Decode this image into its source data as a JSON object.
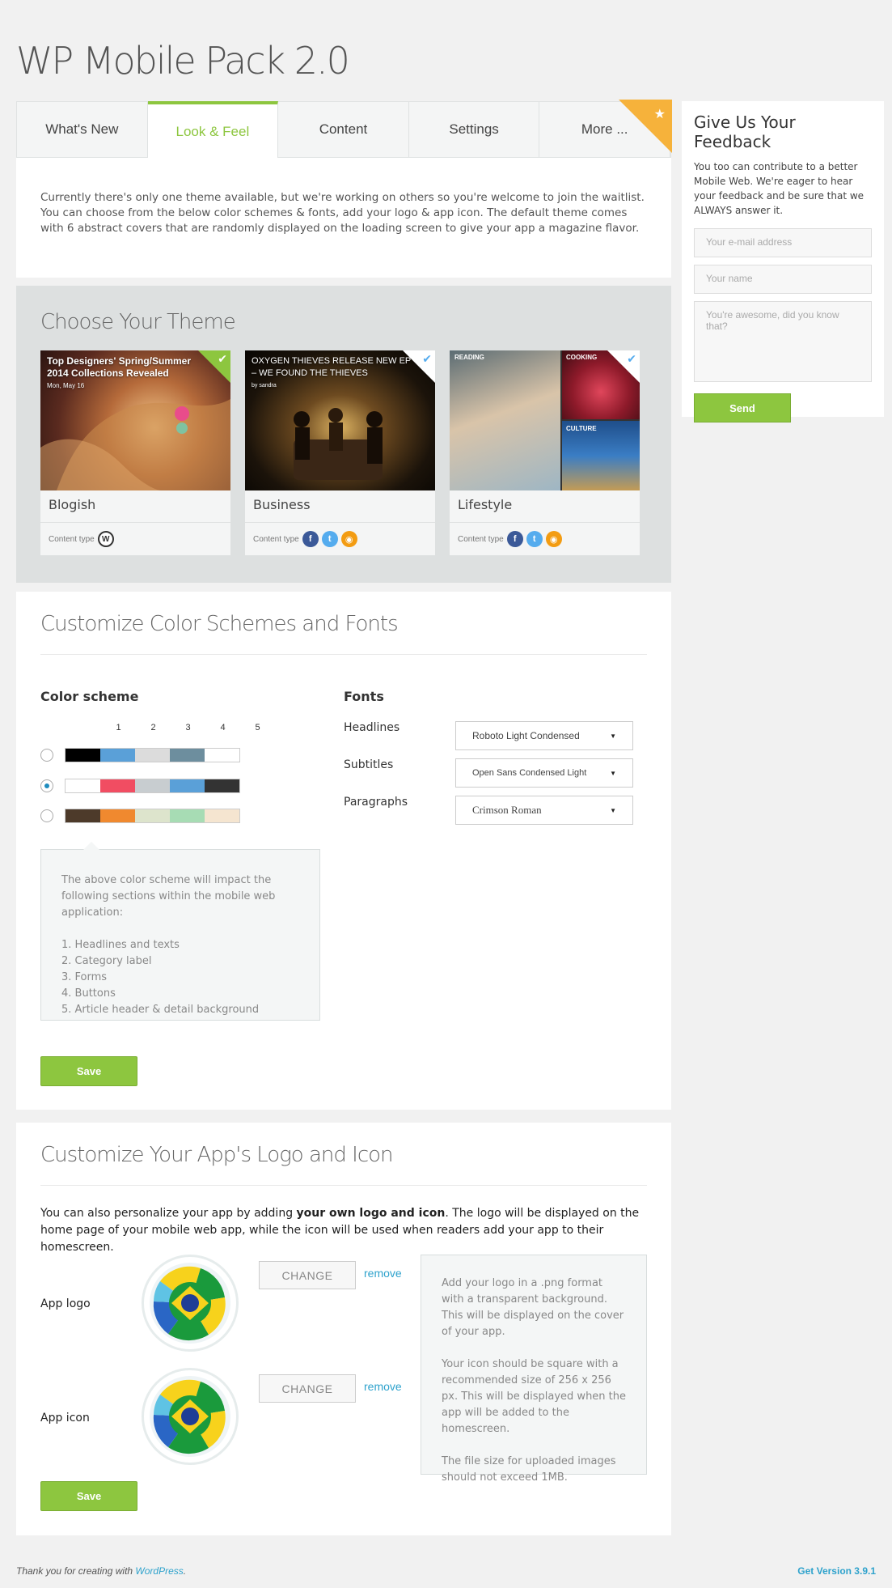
{
  "page_title": "WP Mobile Pack 2.0",
  "tabs": [
    {
      "label": "What's New"
    },
    {
      "label": "Look & Feel"
    },
    {
      "label": "Content"
    },
    {
      "label": "Settings"
    },
    {
      "label": "More ..."
    }
  ],
  "intro": "Currently there's only one theme available, but we're working on others so you're welcome to join the waitlist. You can choose from the below color schemes & fonts, add your logo & app icon. The default theme comes with 6 abstract covers that are randomly displayed on the loading screen to give your app a magazine flavor.",
  "theme_section": {
    "title": "Choose Your Theme",
    "themes": [
      {
        "name": "Blogish",
        "content_type": "Content type",
        "img_title": "Top Designers' Spring/Summer 2014 Collections Revealed",
        "img_sub": "Mon, May 16"
      },
      {
        "name": "Business",
        "content_type": "Content type",
        "img_title": "OXYGEN THIEVES RELEASE NEW EP – WE FOUND THE THIEVES",
        "img_sub": "by sandra"
      },
      {
        "name": "Lifestyle",
        "content_type": "Content type",
        "img_labels": [
          "READING",
          "COOKING",
          "CULTURE"
        ]
      }
    ]
  },
  "colors_section": {
    "title": "Customize Color Schemes and Fonts",
    "color_scheme_label": "Color scheme",
    "numbers": [
      "1",
      "2",
      "3",
      "4",
      "5"
    ],
    "schemes": [
      {
        "colors": [
          "#000000",
          "#5aa0d8",
          "#dcdcdc",
          "#6d8e9e",
          "#ffffff"
        ],
        "selected": false
      },
      {
        "colors": [
          "#ffffff",
          "#f14d62",
          "#c8cdd0",
          "#5aa0d8",
          "#333333"
        ],
        "selected": true
      },
      {
        "colors": [
          "#4d3a2a",
          "#f0892f",
          "#dde4cc",
          "#a7dcb4",
          "#f5e5d0"
        ],
        "selected": false
      }
    ],
    "info_intro": "The above color scheme will impact the following sections within the mobile web application:",
    "info_items": [
      "1. Headlines and texts",
      "2. Category label",
      "3. Forms",
      "4. Buttons",
      "5. Article header & detail background"
    ],
    "fonts_label": "Fonts",
    "fonts": [
      {
        "label": "Headlines",
        "value": "Roboto Light Condensed"
      },
      {
        "label": "Subtitles",
        "value": "Open Sans Condensed Light"
      },
      {
        "label": "Paragraphs",
        "value": "Crimson Roman"
      }
    ],
    "save_label": "Save"
  },
  "logo_section": {
    "title": "Customize Your App's Logo and Icon",
    "text_pre": "You can also personalize your app by adding ",
    "text_bold": "your own logo and icon",
    "text_post": ". The logo will be displayed on the home page of your mobile web app, while the icon will be used when readers add your app to their homescreen.",
    "app_logo_label": "App logo",
    "app_icon_label": "App icon",
    "change_label": "CHANGE",
    "remove_label": "remove",
    "info": [
      "Add your logo in a .png format with a transparent background. This will be displayed on the cover of your app.",
      "Your icon should be square with a recommended size of 256 x 256 px. This will be displayed when the app will be added to the homescreen.",
      "The file size for uploaded images should not exceed 1MB."
    ],
    "save_label": "Save"
  },
  "feedback": {
    "title": "Give Us Your Feedback",
    "text": "You too can contribute to a better Mobile Web. We're eager to hear your feedback and be sure that we ALWAYS answer it.",
    "email_placeholder": "Your e-mail address",
    "name_placeholder": "Your name",
    "message_placeholder": "You're awesome, did you know that?",
    "send_label": "Send"
  },
  "footer": {
    "text_pre": "Thank you for creating with ",
    "link": "WordPress",
    "text_post": ".",
    "version": "Get Version 3.9.1"
  },
  "colors": {
    "accent": "#8dc63f",
    "ribbon": "#f6b23b",
    "link": "#2ea2cc"
  }
}
